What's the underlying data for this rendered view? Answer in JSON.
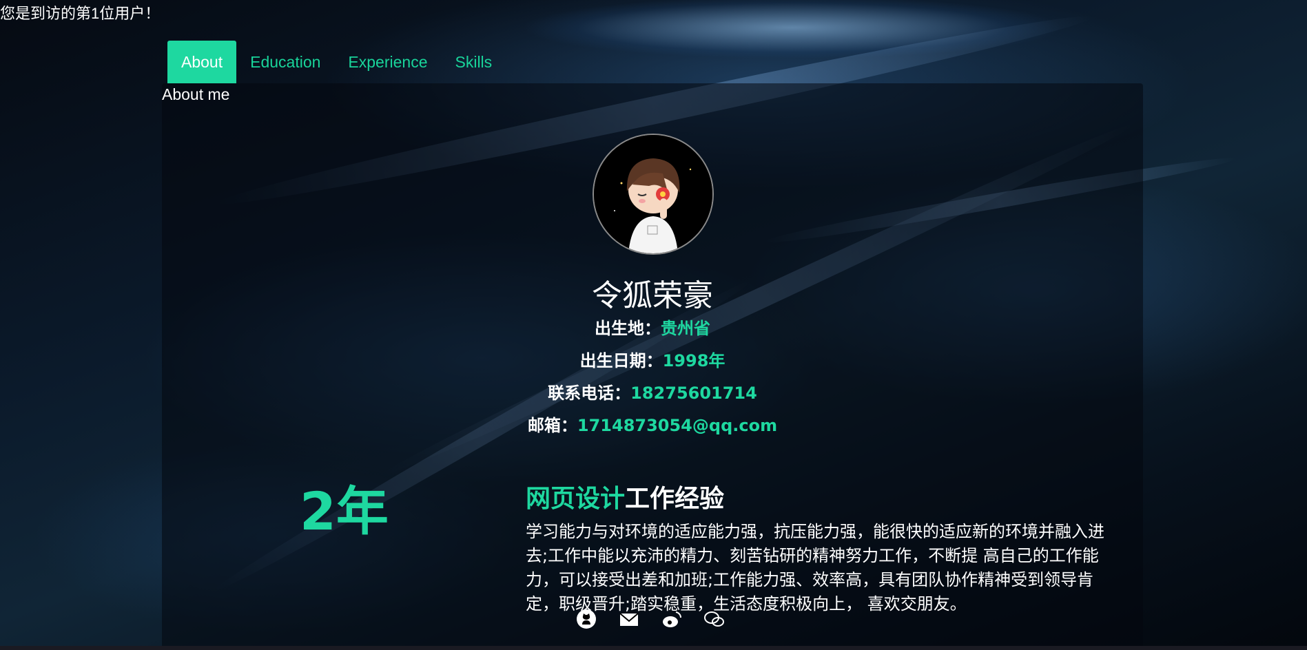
{
  "visitor_text": "您是到访的第1位用户！",
  "tabs": [
    "About",
    "Education",
    "Experience",
    "Skills"
  ],
  "active_tab": "About",
  "panel": {
    "title": "About me",
    "name": "令狐荣豪",
    "info": [
      {
        "label": "出生地：",
        "value": "贵州省"
      },
      {
        "label": "出生日期：",
        "value": "1998年"
      },
      {
        "label": "联系电话：",
        "value": "18275601714"
      },
      {
        "label": "邮箱：",
        "value": "1714873054@qq.com"
      }
    ],
    "years": "2年",
    "exp_title_highlight": "网页设计",
    "exp_title_rest": "工作经验",
    "exp_desc": "学习能力与对环境的适应能力强，抗压能力强，能很快的适应新的环境并融入进去;工作中能以充沛的精力、刻苦钻研的精神努力工作，不断提 高自己的工作能力，可以接受出差和加班;工作能力强、效率高，具有团队协作精神受到领导肯定，职级晋升;踏实稳重，生活态度积极向上， 喜欢交朋友。"
  },
  "social_icons": [
    "github-icon",
    "mail-icon",
    "weibo-icon",
    "wechat-icon"
  ],
  "colors": {
    "accent": "#1ed8a0",
    "background": "#07111c",
    "text": "#ffffff"
  }
}
